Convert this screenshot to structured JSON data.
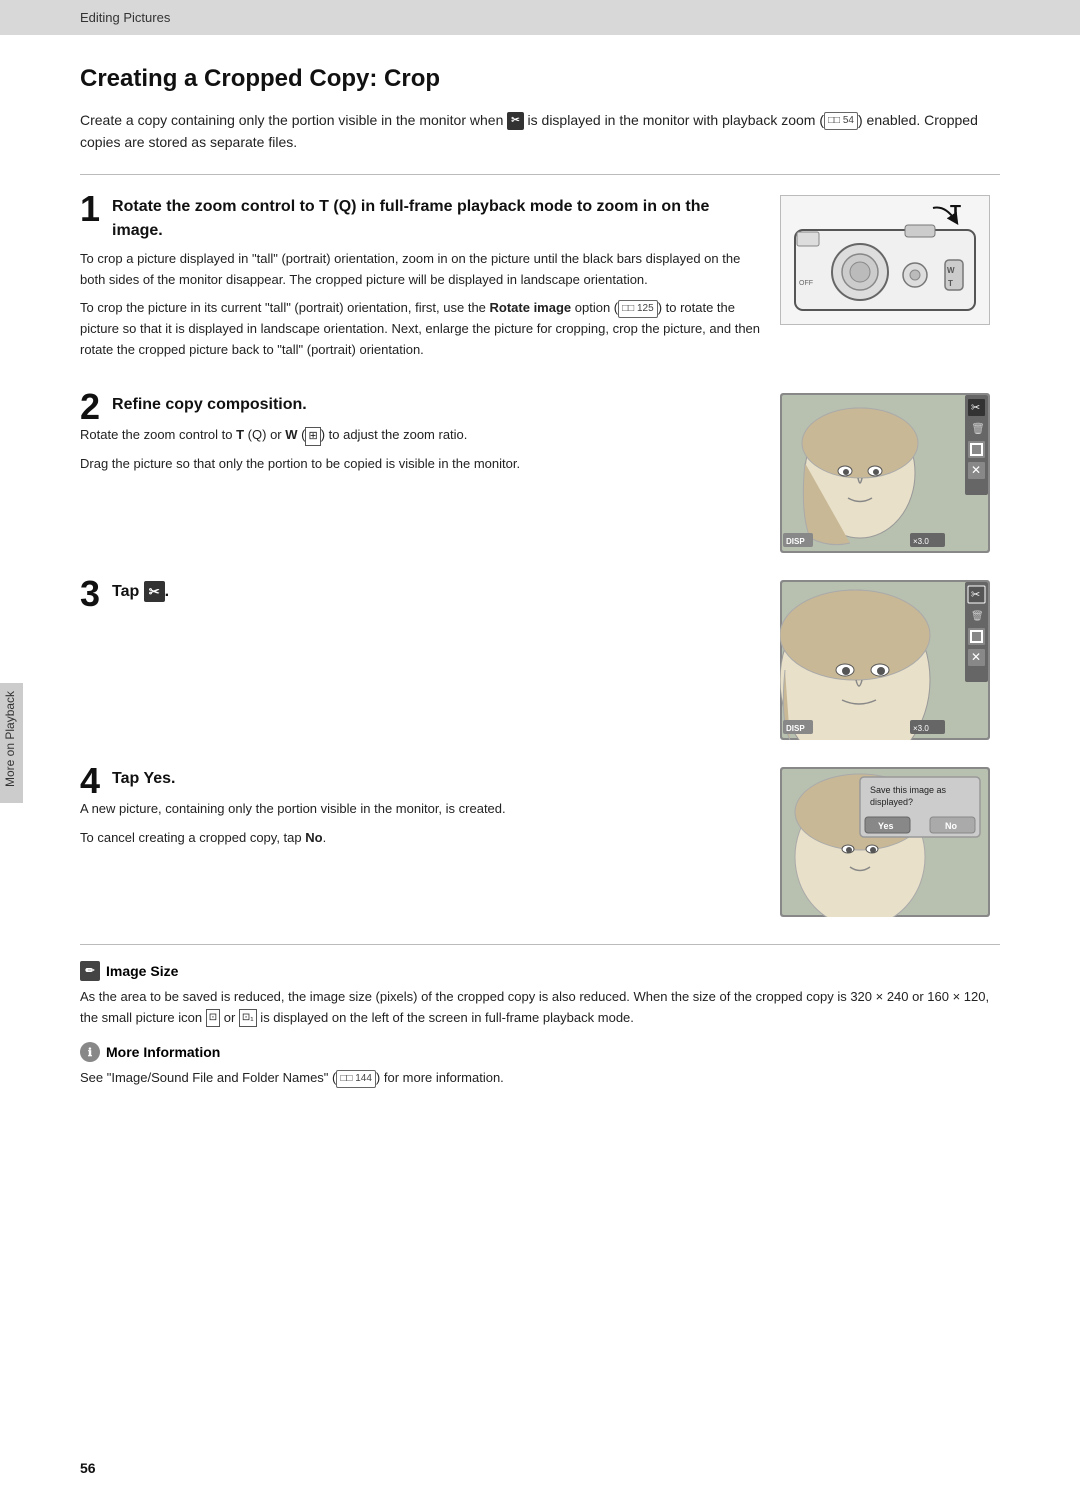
{
  "header": {
    "breadcrumb": "Editing Pictures"
  },
  "sidebar": {
    "label": "More on Playback"
  },
  "page": {
    "title": "Creating a Cropped Copy: Crop",
    "intro": "Create a copy containing only the portion visible in the monitor when",
    "intro2": "is displayed in the monitor with playback zoom (",
    "intro_ref": "54",
    "intro3": ") enabled. Cropped copies are stored as separate files.",
    "steps": [
      {
        "number": "1",
        "title_part1": "Rotate the zoom control to ",
        "title_T": "T",
        "title_part2": " (",
        "title_Q": "Q",
        "title_part3": ") in full-frame playback mode to zoom in on the image.",
        "body": [
          "To crop a picture displayed in \"tall\" (portrait) orientation, zoom in on the picture until the black bars displayed on the both sides of the monitor disappear. The cropped picture will be displayed in landscape orientation.",
          "To crop the picture in its current \"tall\" (portrait) orientation, first, use the Rotate image option (",
          "125",
          ") to rotate the picture so that it is displayed in landscape orientation. Next, enlarge the picture for cropping, crop the picture, and then rotate the cropped picture back to \"tall\" (portrait) orientation."
        ]
      },
      {
        "number": "2",
        "title": "Refine copy composition.",
        "body1": "Rotate the zoom control to T (",
        "body1_q": "Q",
        "body1_2": ") or W (",
        "body1_w": "W",
        "body1_3": ") to adjust the zoom ratio.",
        "body2": "Drag the picture so that only the portion to be copied is visible in the monitor."
      },
      {
        "number": "3",
        "title_pre": "Tap ",
        "title_icon": "✂",
        "title_post": "."
      },
      {
        "number": "4",
        "title_pre": "Tap ",
        "title_bold": "Yes",
        "title_post": ".",
        "body1": "A new picture, containing only the portion visible in the monitor, is created.",
        "body2": "To cancel creating a cropped copy, tap ",
        "body2_bold": "No",
        "body2_post": "."
      }
    ],
    "notes": [
      {
        "type": "pencil",
        "title": "Image Size",
        "text1": "As the area to be saved is reduced, the image size (pixels) of the cropped copy is also reduced. When the size of the cropped copy is 320 × 240 or 160 × 120, the small picture icon",
        "text2": "or",
        "text3": "is displayed on the left of the screen in full-frame playback mode."
      },
      {
        "type": "info",
        "title": "More Information",
        "text": "See \"Image/Sound File and Folder Names\" (",
        "ref": "144",
        "text2": ") for more information."
      }
    ],
    "page_number": "56"
  }
}
